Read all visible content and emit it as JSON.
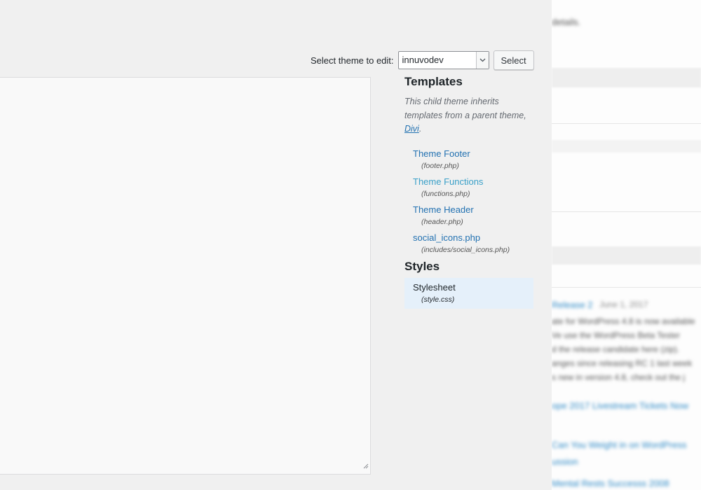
{
  "theme_selector": {
    "label": "Select theme to edit:",
    "selected": "innuvodev",
    "button_label": "Select"
  },
  "templates": {
    "title": "Templates",
    "note_prefix": "This child theme inherits templates from a parent theme, ",
    "parent_theme": "Divi",
    "note_suffix": ".",
    "files": [
      {
        "label": "Theme Footer",
        "file": "(footer.php)"
      },
      {
        "label": "Theme Functions",
        "file": "(functions.php)"
      },
      {
        "label": "Theme Header",
        "file": "(header.php)"
      },
      {
        "label": "social_icons.php",
        "file": "(includes/social_icons.php)"
      }
    ]
  },
  "styles": {
    "title": "Styles",
    "files": [
      {
        "label": "Stylesheet",
        "file": "(style.css)"
      }
    ]
  },
  "background": {
    "line_1": "details.",
    "news_title": "Release 2",
    "news_date": "June 1, 2017",
    "news_lines": [
      "ate for WordPress 4.8 is now available",
      "Ve use the WordPress Beta Tester",
      "d the release candidate here (zip).",
      "anges since releasing RC 1 last week",
      "s new in version 4.8, check out the j"
    ],
    "link_1": "ope 2017 Livestream Tickets Now",
    "link_2a": "Can You Weight in on WordPress",
    "link_2b": "ussion",
    "link_3": "Mental Rests Successs 2008"
  },
  "colors": {
    "link": "#2271b1",
    "selected_bg": "#e5f0fa",
    "panel_bg": "#f0f0f0"
  }
}
